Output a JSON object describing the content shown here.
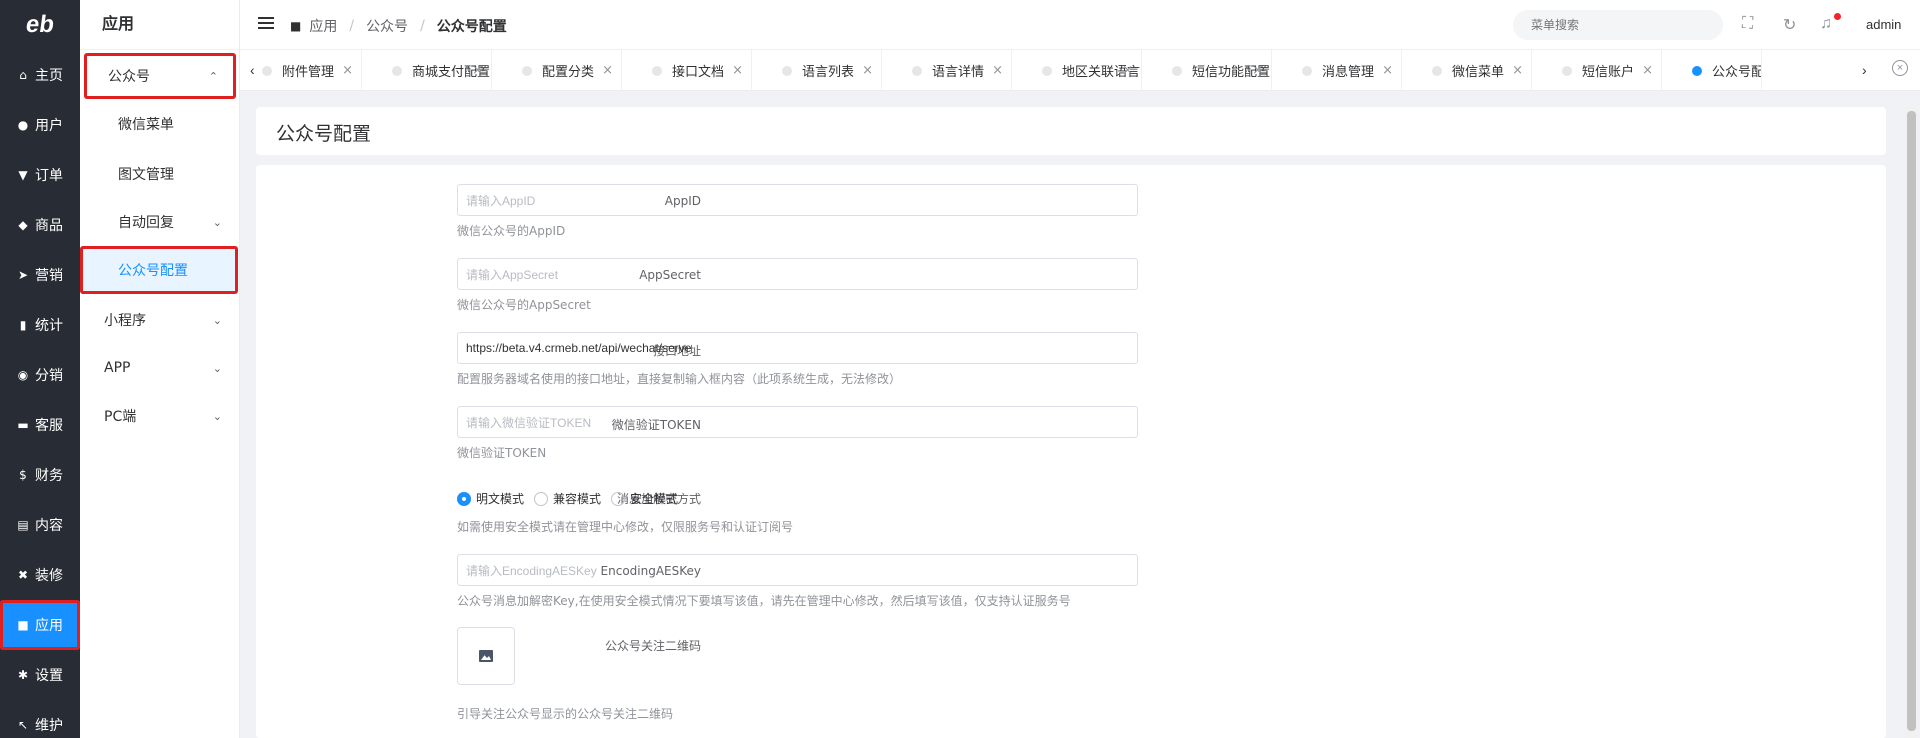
{
  "rail": {
    "logo": "eb",
    "items": [
      {
        "label": "主页",
        "icon": "home-icon",
        "glyph": "⌂"
      },
      {
        "label": "用户",
        "icon": "user-icon",
        "glyph": "●"
      },
      {
        "label": "订单",
        "icon": "cart-icon",
        "glyph": "▼"
      },
      {
        "label": "商品",
        "icon": "basket-icon",
        "glyph": "◆"
      },
      {
        "label": "营销",
        "icon": "send-icon",
        "glyph": "➤"
      },
      {
        "label": "统计",
        "icon": "bar-chart-icon",
        "glyph": "▮"
      },
      {
        "label": "分销",
        "icon": "handshake-icon",
        "glyph": "◉"
      },
      {
        "label": "客服",
        "icon": "chat-icon",
        "glyph": "▬"
      },
      {
        "label": "财务",
        "icon": "dollar-icon",
        "glyph": "$"
      },
      {
        "label": "内容",
        "icon": "book-icon",
        "glyph": "▤"
      },
      {
        "label": "装修",
        "icon": "tools-icon",
        "glyph": "✖"
      },
      {
        "label": "应用",
        "icon": "cube-icon",
        "glyph": "■",
        "active": true
      },
      {
        "label": "设置",
        "icon": "gear-icon",
        "glyph": "✱"
      },
      {
        "label": "维护",
        "icon": "hammer-icon",
        "glyph": "↖"
      }
    ]
  },
  "submenu": {
    "title": "应用",
    "items": [
      {
        "label": "公众号",
        "level": 1,
        "chevron": "up"
      },
      {
        "label": "微信菜单",
        "level": 2
      },
      {
        "label": "图文管理",
        "level": 2
      },
      {
        "label": "自动回复",
        "level": 2,
        "chevron": "down"
      },
      {
        "label": "公众号配置",
        "level": 2,
        "selected": true
      },
      {
        "label": "小程序",
        "level": 1,
        "chevron": "down"
      },
      {
        "label": "APP",
        "level": 1,
        "chevron": "down"
      },
      {
        "label": "PC端",
        "level": 1,
        "chevron": "down"
      }
    ]
  },
  "header": {
    "breadcrumbs": [
      "应用",
      "公众号",
      "公众号配置"
    ],
    "search_placeholder": "菜单搜索",
    "user": "admin"
  },
  "tabs": [
    {
      "label": "附件管理"
    },
    {
      "label": "商城支付配置"
    },
    {
      "label": "配置分类"
    },
    {
      "label": "接口文档"
    },
    {
      "label": "语言列表"
    },
    {
      "label": "语言详情"
    },
    {
      "label": "地区关联语言"
    },
    {
      "label": "短信功能配置"
    },
    {
      "label": "消息管理"
    },
    {
      "label": "微信菜单"
    },
    {
      "label": "短信账户"
    },
    {
      "label": "公众号配置",
      "active": true
    }
  ],
  "page": {
    "title": "公众号配置"
  },
  "form": {
    "appid": {
      "label": "AppID",
      "placeholder": "请输入AppID",
      "help": "微信公众号的AppID"
    },
    "appsecret": {
      "label": "AppSecret",
      "placeholder": "请输入AppSecret",
      "help": "微信公众号的AppSecret"
    },
    "api_url": {
      "label": "接口地址",
      "value": "https://beta.v4.crmeb.net/api/wechat/serve",
      "help": "配置服务器域名使用的接口地址，直接复制输入框内容（此项系统生成，无法修改）"
    },
    "token": {
      "label": "微信验证TOKEN",
      "placeholder": "请输入微信验证TOKEN",
      "help": "微信验证TOKEN"
    },
    "encrypt_mode": {
      "label": "消息加解密方式",
      "options": [
        "明文模式",
        "兼容模式",
        "安全模式"
      ],
      "selected": "明文模式",
      "help": "如需使用安全模式请在管理中心修改，仅限服务号和认证订阅号"
    },
    "aeskey": {
      "label": "EncodingAESKey",
      "placeholder": "请输入EncodingAESKey",
      "help": "公众号消息加解密Key,在使用安全模式情况下要填写该值，请先在管理中心修改，然后填写该值，仅支持认证服务号"
    },
    "qrcode": {
      "label": "公众号关注二维码",
      "help": "引导关注公众号显示的公众号关注二维码"
    }
  },
  "colors": {
    "primary": "#1890ff",
    "rail_bg": "#282c34",
    "highlight_box": "#e02020"
  }
}
